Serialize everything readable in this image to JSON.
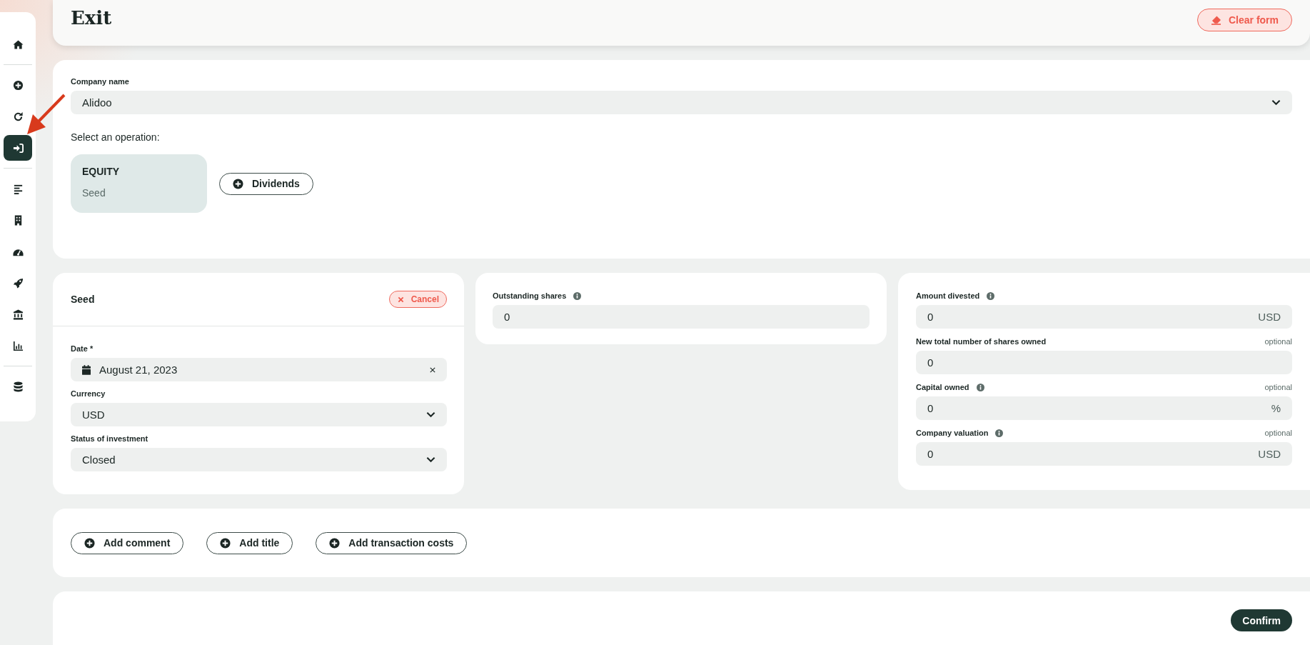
{
  "sidebar": {
    "groups": [
      {
        "items": [
          {
            "selected": false
          }
        ]
      },
      {
        "items": [
          {
            "selected": false
          },
          {
            "selected": false
          },
          {
            "selected": true
          }
        ]
      },
      {
        "items": [
          {
            "selected": false
          },
          {
            "selected": false
          },
          {
            "selected": false
          },
          {
            "selected": false
          },
          {
            "selected": false
          },
          {
            "selected": false
          }
        ]
      },
      {
        "items": [
          {
            "selected": false
          }
        ]
      }
    ]
  },
  "header": {
    "title": "Exit",
    "clear_button": "Clear form"
  },
  "company": {
    "label": "Company name",
    "value": "Alidoo"
  },
  "operation": {
    "prompt": "Select an operation:",
    "tile": {
      "title": "EQUITY",
      "subtitle": "Seed"
    },
    "add_button": "Dividends"
  },
  "seed": {
    "title": "Seed",
    "cancel": "Cancel",
    "fields": [
      {
        "kind": "date",
        "label": "Date *",
        "value": "August 21, 2023"
      },
      {
        "kind": "select",
        "label": "Currency",
        "value": "USD"
      },
      {
        "kind": "select",
        "label": "Status of investment",
        "value": "Closed"
      }
    ]
  },
  "shares": {
    "fields": [
      {
        "label": "Outstanding shares",
        "info": true,
        "value": "0"
      }
    ]
  },
  "divestment": {
    "fields": [
      {
        "label": "Amount divested",
        "info": true,
        "value": "0",
        "unit": "USD"
      },
      {
        "label": "New total number of shares owned",
        "info": false,
        "note": "optional",
        "value": "0"
      },
      {
        "label": "Capital owned",
        "info": true,
        "note": "optional",
        "value": "0",
        "unit": "%"
      },
      {
        "label": "Company valuation",
        "info": true,
        "note": "optional",
        "value": "0",
        "unit": "USD"
      }
    ]
  },
  "actions": [
    "Add comment",
    "Add title",
    "Add transaction costs"
  ],
  "confirm": "Confirm"
}
